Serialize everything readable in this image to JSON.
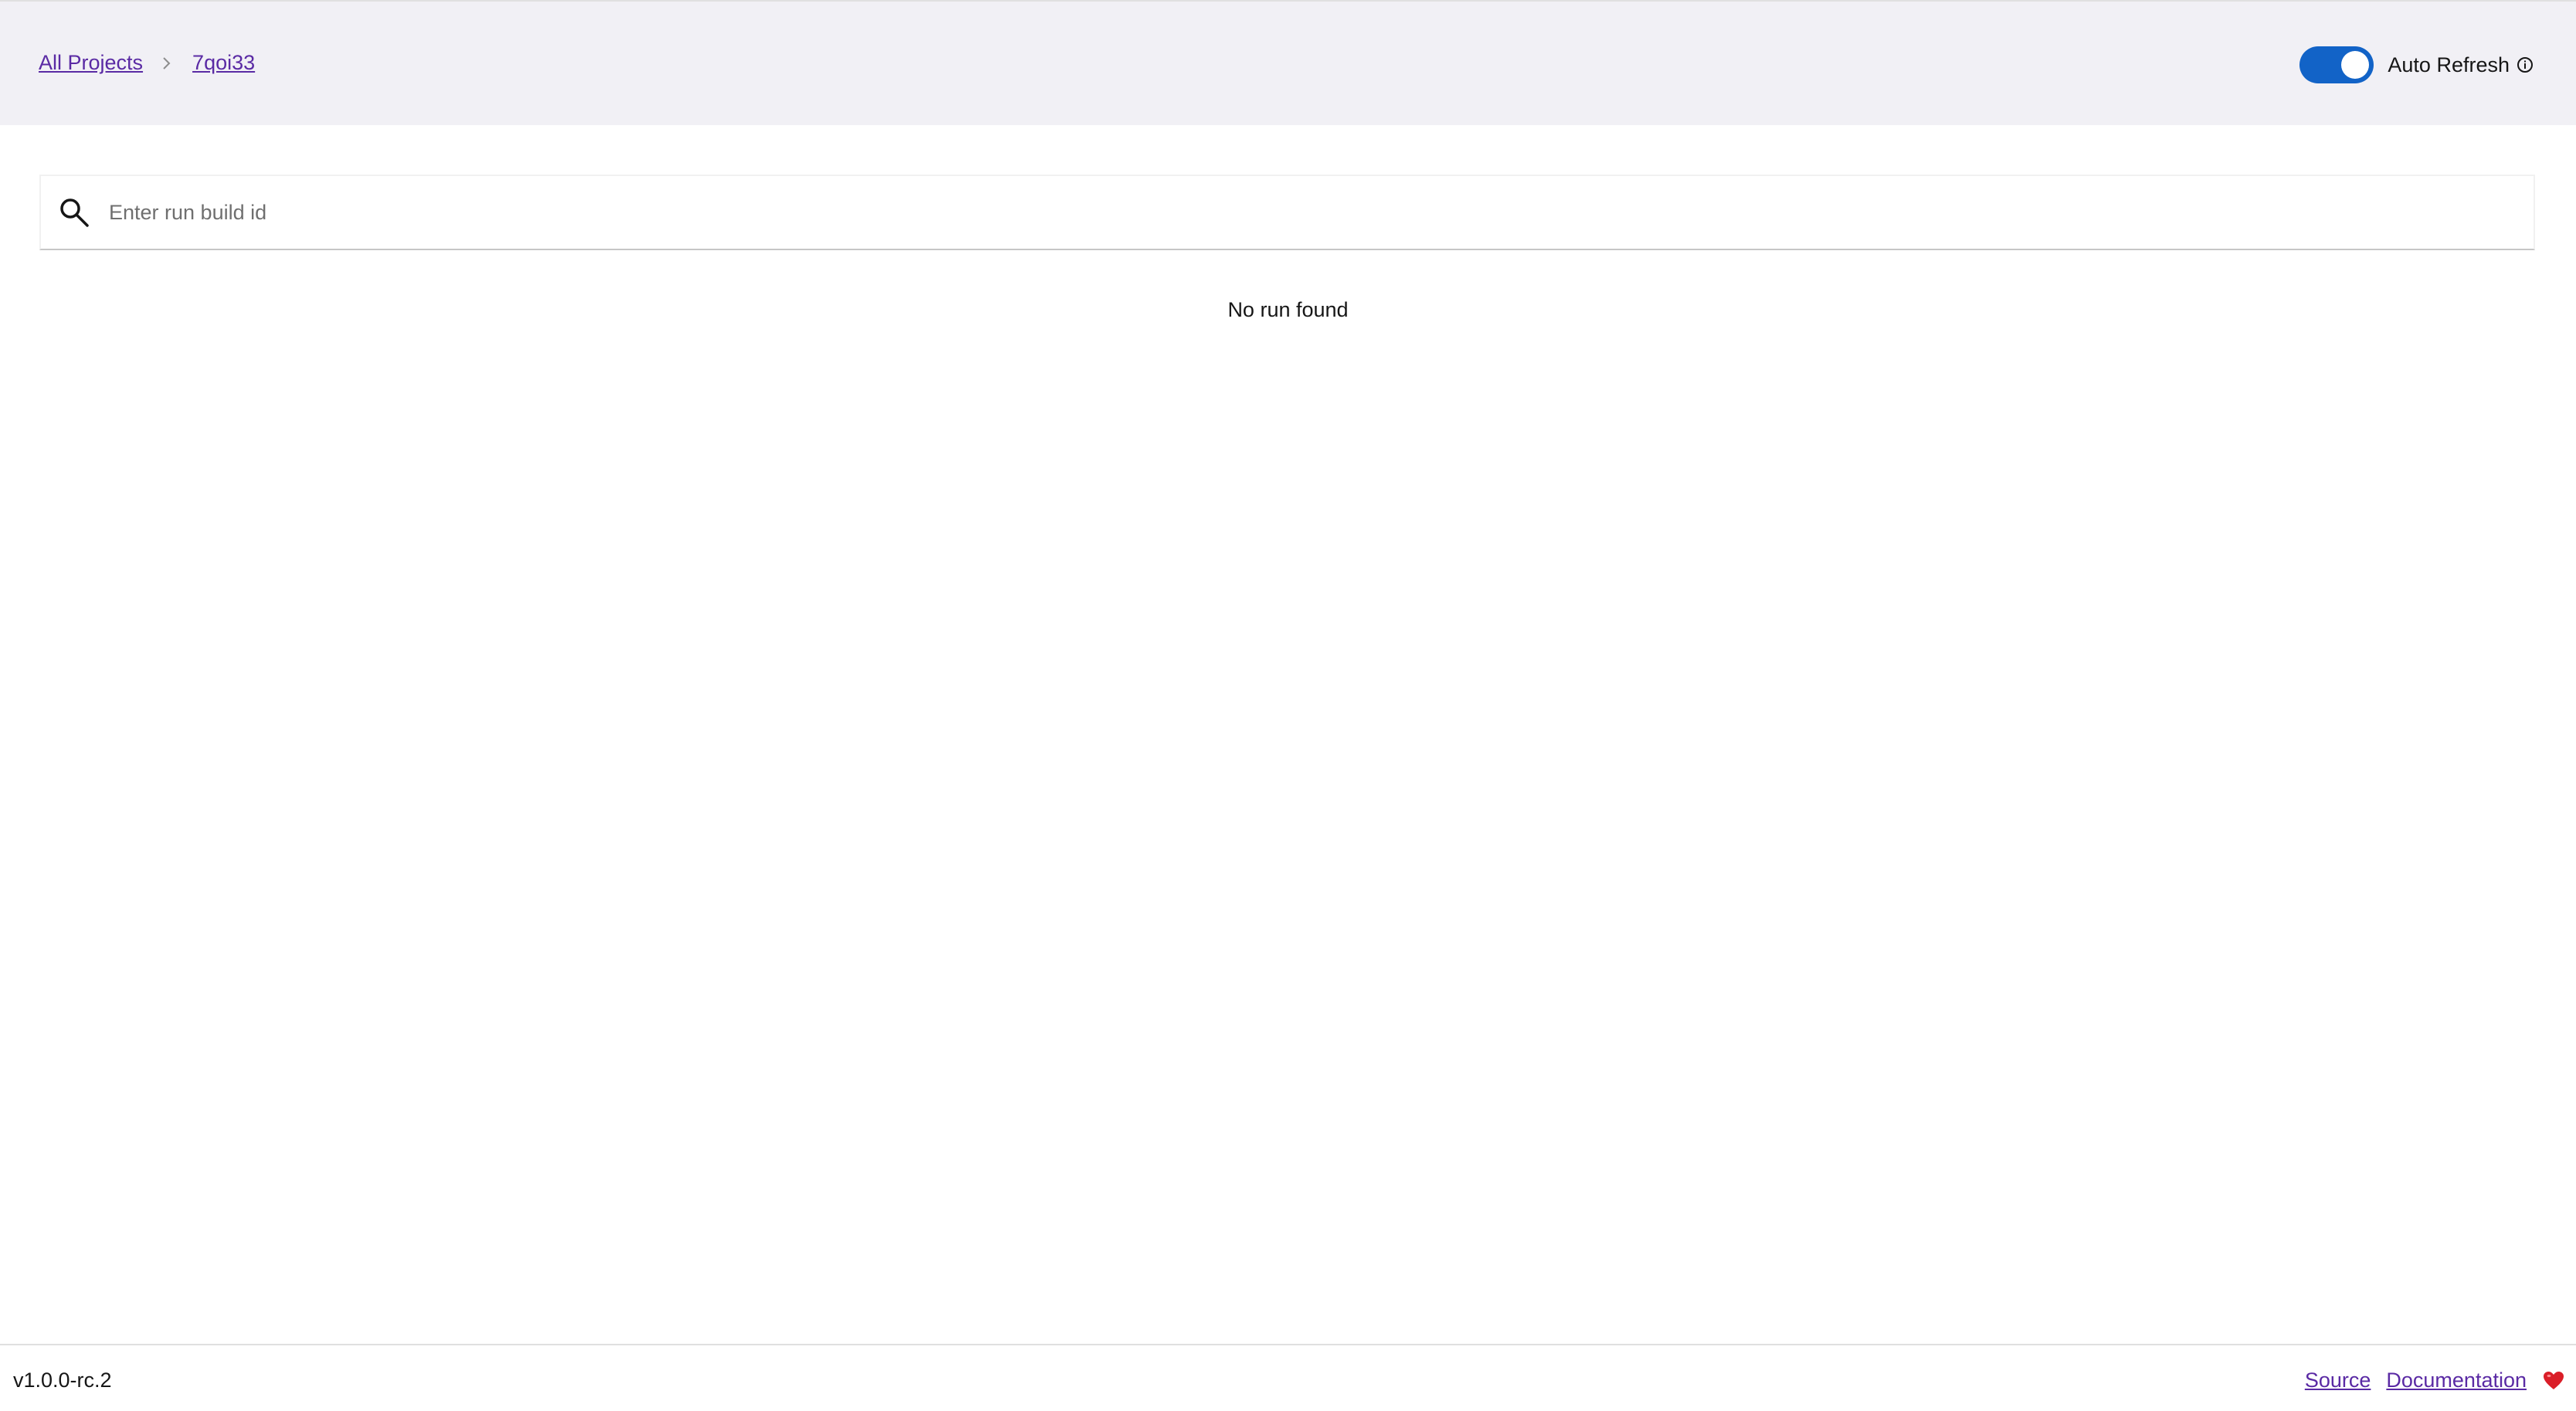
{
  "header": {
    "breadcrumb": [
      {
        "label": "All Projects"
      },
      {
        "label": "7qoi33"
      }
    ],
    "auto_refresh": {
      "label": "Auto Refresh",
      "enabled": true
    }
  },
  "search": {
    "placeholder": "Enter run build id",
    "value": ""
  },
  "main": {
    "empty_message": "No run found"
  },
  "footer": {
    "version": "v1.0.0-rc.2",
    "links": [
      {
        "label": "Source"
      },
      {
        "label": "Documentation"
      }
    ]
  },
  "colors": {
    "header_bg": "#f1f0f5",
    "link": "#5a2aa4",
    "toggle_on": "#1263c7",
    "heart": "#da1e28"
  },
  "icons": [
    "chevron-right-icon",
    "info-icon",
    "search-icon",
    "heart-icon"
  ]
}
